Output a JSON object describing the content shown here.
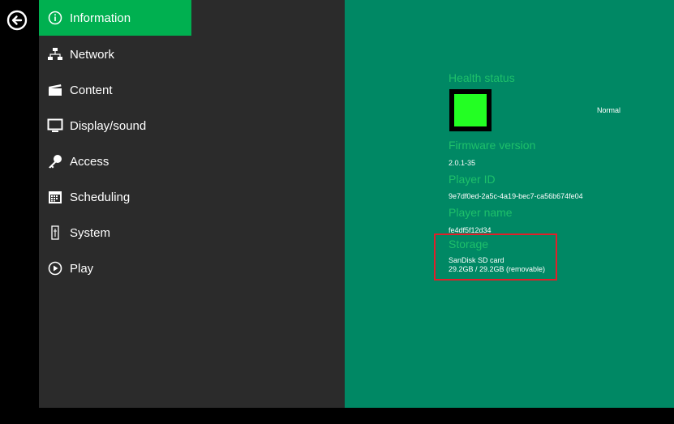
{
  "menu": {
    "items": [
      {
        "label": "Information",
        "icon": "info-icon"
      },
      {
        "label": "Network",
        "icon": "network-icon"
      },
      {
        "label": "Content",
        "icon": "clapperboard-icon"
      },
      {
        "label": "Display/sound",
        "icon": "monitor-icon"
      },
      {
        "label": "Access",
        "icon": "key-icon"
      },
      {
        "label": "Scheduling",
        "icon": "calendar-icon"
      },
      {
        "label": "System",
        "icon": "system-icon"
      },
      {
        "label": "Play",
        "icon": "play-icon"
      }
    ],
    "active_index": 0
  },
  "info": {
    "health_label": "Health status",
    "health_value": "Normal",
    "firmware_label": "Firmware version",
    "firmware_value": "2.0.1-35",
    "player_id_label": "Player ID",
    "player_id_value": "9e7df0ed-2a5c-4a19-bec7-ca56b674fe04",
    "player_name_label": "Player name",
    "player_name_value": "fe4df5f12d34",
    "storage_label": "Storage",
    "storage_device": "SanDisk SD card",
    "storage_capacity": "29.2GB / 29.2GB (removable)"
  },
  "colors": {
    "accent_green": "#00b050",
    "panel_green": "#008864",
    "label_green": "#1ec06a",
    "health_ok": "#23ff23",
    "highlight_red": "#e0202a"
  }
}
